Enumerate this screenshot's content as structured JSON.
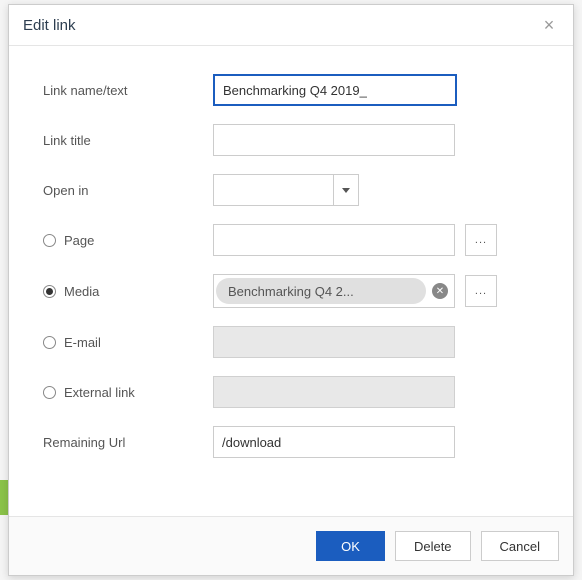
{
  "dialog": {
    "title": "Edit link",
    "labels": {
      "link_name": "Link name/text",
      "link_title": "Link title",
      "open_in": "Open in",
      "page": "Page",
      "media": "Media",
      "email": "E-mail",
      "external": "External link",
      "remaining_url": "Remaining Url"
    },
    "values": {
      "link_name": "Benchmarking Q4 2019_",
      "link_title": "",
      "open_in": "",
      "page": "",
      "media_chip": "Benchmarking Q4 2...",
      "email": "",
      "external": "",
      "remaining_url": "/download"
    },
    "buttons": {
      "ok": "OK",
      "delete": "Delete",
      "cancel": "Cancel",
      "browse": "..."
    },
    "selected_type": "media"
  }
}
